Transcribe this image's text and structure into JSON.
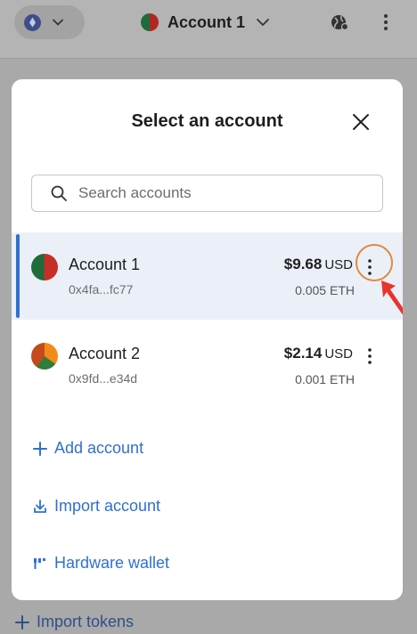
{
  "header": {
    "network_icon": "ethereum-network-icon",
    "account_name": "Account 1"
  },
  "modal": {
    "title": "Select an account",
    "search": {
      "placeholder": "Search accounts",
      "value": ""
    },
    "accounts": [
      {
        "name": "Account 1",
        "address": "0x4fa...fc77",
        "fiat_amount": "$9.68",
        "fiat_currency": "USD",
        "eth_amount": "0.005 ETH",
        "selected": true
      },
      {
        "name": "Account 2",
        "address": "0x9fd...e34d",
        "fiat_amount": "$2.14",
        "fiat_currency": "USD",
        "eth_amount": "0.001 ETH",
        "selected": false
      }
    ],
    "actions": {
      "add_account": "Add account",
      "import_account": "Import account",
      "hardware_wallet": "Hardware wallet"
    }
  },
  "footer": {
    "import_tokens": "Import tokens"
  },
  "colors": {
    "accent": "#2f70d1",
    "highlight": "#e08a3c",
    "annotation_arrow": "#e8352a"
  }
}
